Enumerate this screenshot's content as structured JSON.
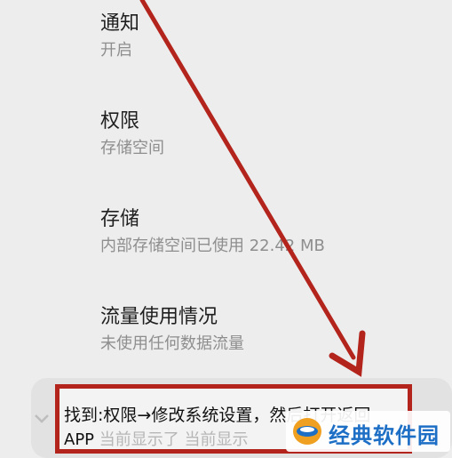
{
  "settings": {
    "notification": {
      "title": "通知",
      "subtitle": "开启"
    },
    "permissions": {
      "title": "权限",
      "subtitle": "存储空间"
    },
    "storage": {
      "title": "存储",
      "subtitle": "内部存储空间已使用 22.42 MB"
    },
    "data_usage": {
      "title": "流量使用情况",
      "subtitle": "未使用任何数据流量"
    }
  },
  "bottom_panel": {
    "instruction_line1": "找到:权限→修改系统设置，然后打开返回",
    "instruction_line2_prefix": "APP",
    "instruction_line2_faded": " 当前显示了 当前显示"
  },
  "watermark": {
    "text": "经典软件园"
  },
  "colors": {
    "annotation_red": "#b3241c",
    "watermark_blue": "#1d6fc6"
  },
  "icons": [
    "chevron-down-icon",
    "watermark-logo-icon"
  ]
}
